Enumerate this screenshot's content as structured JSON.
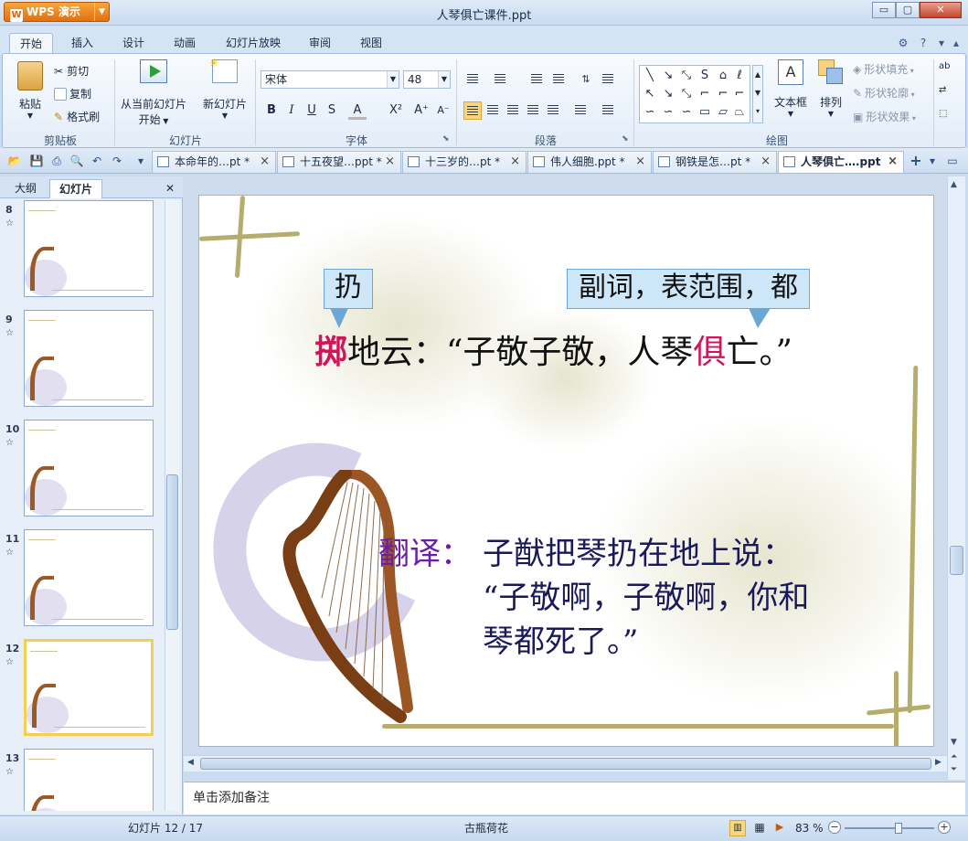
{
  "app": {
    "brand": "WPS 演示",
    "window_title": "人琴俱亡课件.ppt"
  },
  "window_controls": {
    "minimize": "▭",
    "restore": "▢",
    "close": "✕"
  },
  "menu_tabs": [
    "开始",
    "插入",
    "设计",
    "动画",
    "幻灯片放映",
    "审阅",
    "视图"
  ],
  "menu_right_icons": [
    "?",
    "?",
    "▴"
  ],
  "ribbon": {
    "clipboard": {
      "paste": "粘贴",
      "cut": "剪切",
      "copy": "复制",
      "format_painter": "格式刷",
      "group": "剪贴板"
    },
    "slides": {
      "from_current": "从当前幻灯片",
      "start": "开始",
      "new_slide": "新幻灯片",
      "group": "幻灯片"
    },
    "font": {
      "name": "宋体",
      "size": "48",
      "bold": "B",
      "italic": "I",
      "underline": "U",
      "shadow": "S",
      "color": "A",
      "superscript": "X²",
      "grow": "A⁺",
      "shrink": "A⁻",
      "group": "字体"
    },
    "paragraph": {
      "group": "段落"
    },
    "drawing": {
      "textbox": "文本框",
      "arrange": "排列",
      "shape_fill": "形状填充",
      "shape_outline": "形状轮廓",
      "shape_effect": "形状效果",
      "group": "绘图"
    }
  },
  "doc_tabs": [
    {
      "label": "本命年的…pt *",
      "active": false
    },
    {
      "label": "十五夜望…ppt *",
      "active": false
    },
    {
      "label": "十三岁的…pt *",
      "active": false
    },
    {
      "label": "伟人细胞.ppt *",
      "active": false
    },
    {
      "label": "钢铁是怎…pt *",
      "active": false
    },
    {
      "label": "人琴俱亡….ppt",
      "active": true
    }
  ],
  "left_panel": {
    "tabs": [
      "大纲",
      "幻灯片"
    ],
    "close": "✕",
    "thumbnails": [
      {
        "num": "8",
        "selected": false
      },
      {
        "num": "9",
        "selected": false
      },
      {
        "num": "10",
        "selected": false
      },
      {
        "num": "11",
        "selected": false
      },
      {
        "num": "12",
        "selected": true
      },
      {
        "num": "13",
        "selected": false
      }
    ],
    "star": "☆"
  },
  "slide": {
    "callout_left": "扔",
    "callout_right": "副词，表范围，都",
    "line1_red1": "掷",
    "line1_mid": "地云：“子敬子敬，人琴",
    "line1_red2": "俱",
    "line1_end": "亡。”",
    "translation_label": "翻译：",
    "translation_1": "子猷把琴扔在地上说：",
    "translation_2": "“子敬啊，子敬啊，你和",
    "translation_3": "琴都死了。”",
    "colors": {
      "red": "#d4145a",
      "purple": "#6a1fa5",
      "navy": "#1a1a5a"
    }
  },
  "notes_placeholder": "单击添加备注",
  "status": {
    "slide_counter": "幻灯片 12 / 17",
    "theme": "古瓶荷花",
    "zoom": "83 %",
    "zoom_level": 0.6
  }
}
